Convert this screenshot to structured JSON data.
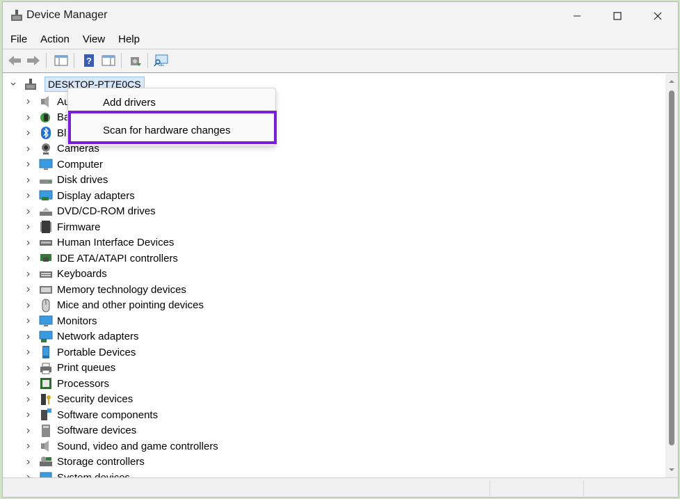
{
  "window": {
    "title": "Device Manager",
    "controls": {
      "minimize": "minimize",
      "maximize": "maximize",
      "close": "close"
    }
  },
  "menubar": {
    "items": [
      "File",
      "Action",
      "View",
      "Help"
    ]
  },
  "toolbar": {
    "buttons": [
      "back-arrow-icon",
      "forward-arrow-icon",
      "show-hide-console-tree-icon",
      "help-icon",
      "properties-icon",
      "update-driver-icon",
      "scan-hardware-icon"
    ]
  },
  "tree": {
    "root": "DESKTOP-PT7E0CS",
    "items": [
      {
        "label": "Au",
        "icon": "audio-inputs-icon"
      },
      {
        "label": "Ba",
        "icon": "batteries-icon"
      },
      {
        "label": "Bl",
        "icon": "bluetooth-icon"
      },
      {
        "label": "Cameras",
        "icon": "camera-icon"
      },
      {
        "label": "Computer",
        "icon": "computer-icon"
      },
      {
        "label": "Disk drives",
        "icon": "disk-drive-icon"
      },
      {
        "label": "Display adapters",
        "icon": "display-adapter-icon"
      },
      {
        "label": "DVD/CD-ROM drives",
        "icon": "dvd-drive-icon"
      },
      {
        "label": "Firmware",
        "icon": "firmware-icon"
      },
      {
        "label": "Human Interface Devices",
        "icon": "hid-icon"
      },
      {
        "label": "IDE ATA/ATAPI controllers",
        "icon": "ide-controller-icon"
      },
      {
        "label": "Keyboards",
        "icon": "keyboard-icon"
      },
      {
        "label": "Memory technology devices",
        "icon": "memory-device-icon"
      },
      {
        "label": "Mice and other pointing devices",
        "icon": "mouse-icon"
      },
      {
        "label": "Monitors",
        "icon": "monitor-icon"
      },
      {
        "label": "Network adapters",
        "icon": "network-adapter-icon"
      },
      {
        "label": "Portable Devices",
        "icon": "portable-device-icon"
      },
      {
        "label": "Print queues",
        "icon": "printer-icon"
      },
      {
        "label": "Processors",
        "icon": "processor-icon"
      },
      {
        "label": "Security devices",
        "icon": "security-device-icon"
      },
      {
        "label": "Software components",
        "icon": "software-component-icon"
      },
      {
        "label": "Software devices",
        "icon": "software-device-icon"
      },
      {
        "label": "Sound, video and game controllers",
        "icon": "speaker-icon"
      },
      {
        "label": "Storage controllers",
        "icon": "storage-controller-icon"
      },
      {
        "label": "System devices",
        "icon": "system-device-icon"
      }
    ]
  },
  "context_menu": {
    "items": [
      "Add drivers",
      "Scan for hardware changes"
    ],
    "highlighted": "Scan for hardware changes",
    "highlight_color": "#7b1fd6"
  }
}
